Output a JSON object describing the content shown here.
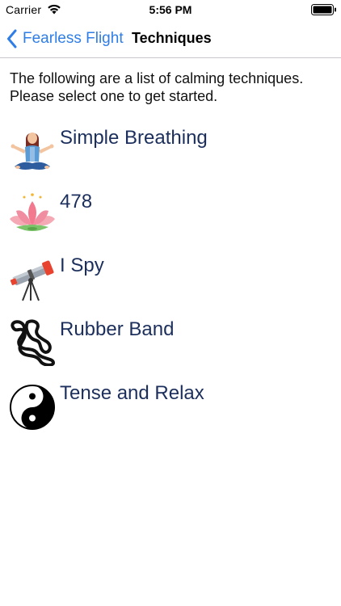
{
  "status_bar": {
    "carrier": "Carrier",
    "time": "5:56 PM"
  },
  "nav": {
    "back_label": "Fearless Flight",
    "title": "Techniques"
  },
  "intro": "The following are a list of calming techniques. Please select one to get started.",
  "techniques": [
    {
      "label": "Simple Breathing",
      "icon": "meditation-icon"
    },
    {
      "label": "478",
      "icon": "lotus-icon"
    },
    {
      "label": "I Spy",
      "icon": "telescope-icon"
    },
    {
      "label": "Rubber Band",
      "icon": "rubber-band-icon"
    },
    {
      "label": "Tense and Relax",
      "icon": "yin-yang-icon"
    }
  ],
  "colors": {
    "accent": "#2f7ee6",
    "item_text": "#1c2f5c",
    "separator": "#c8c7cc"
  }
}
